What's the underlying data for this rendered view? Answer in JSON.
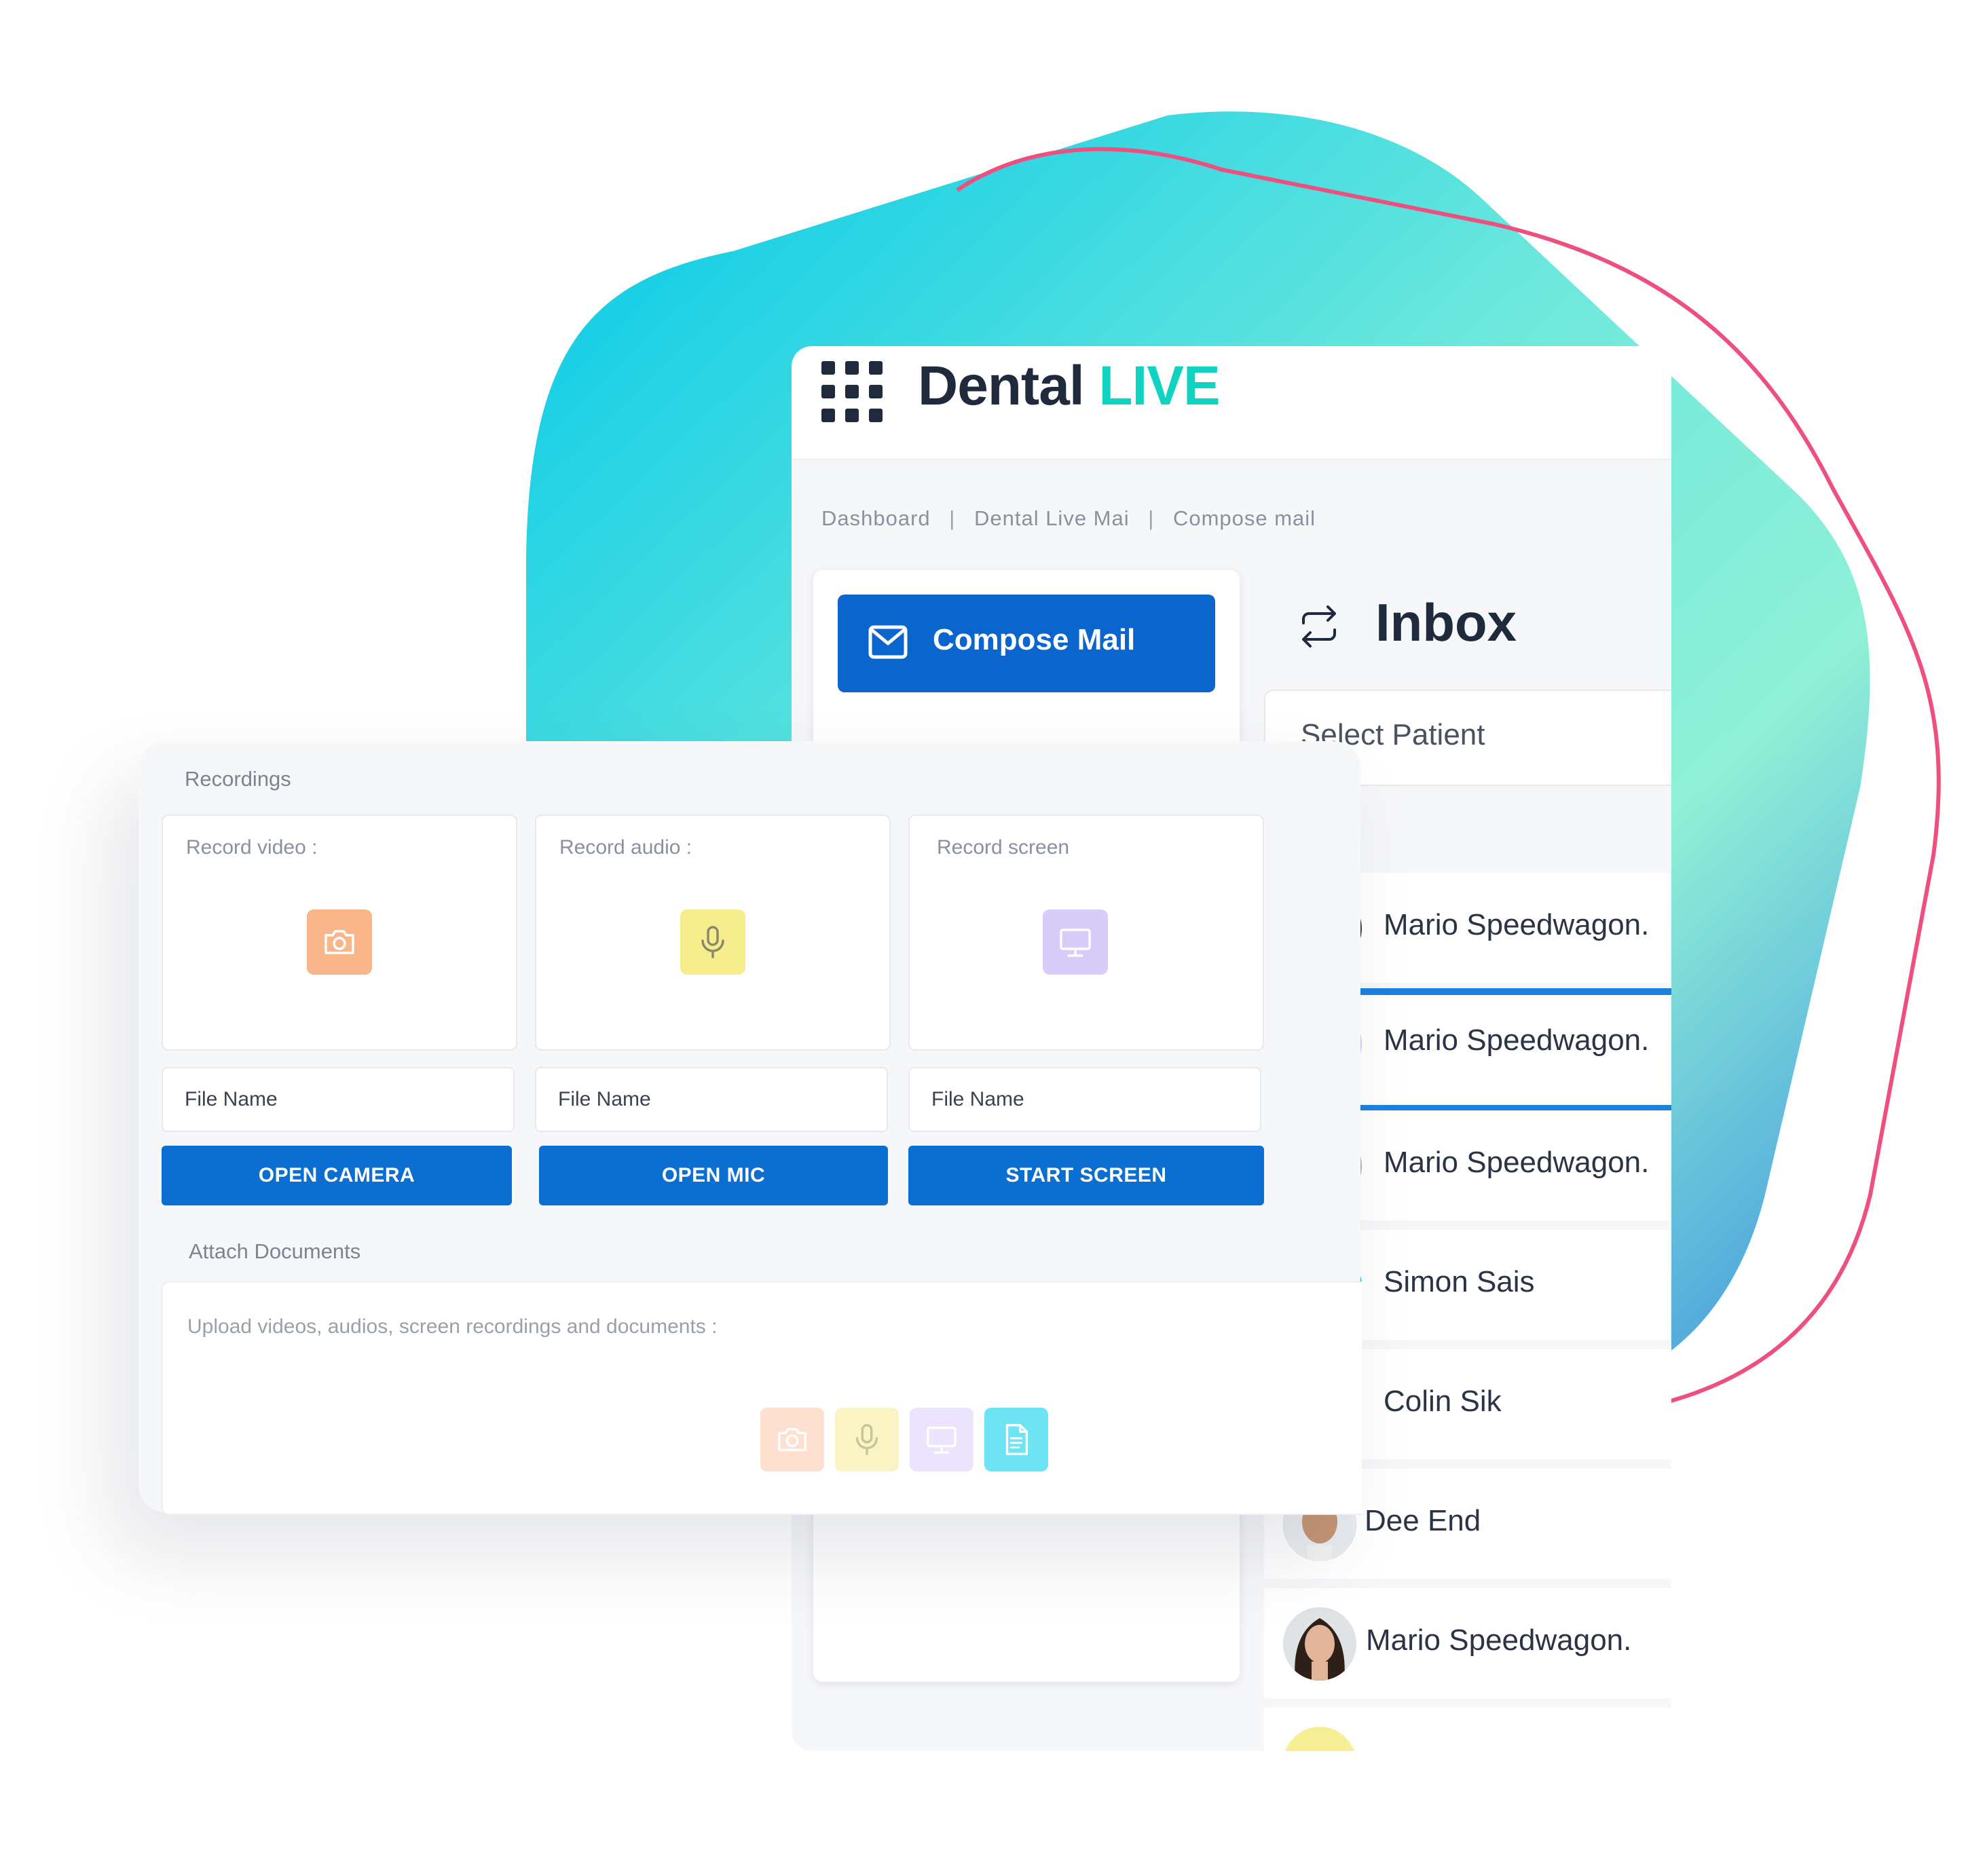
{
  "brand": {
    "name_part1": "Dental",
    "name_part2": "LIVE",
    "accent_color": "#0fd3c0",
    "primary_color": "#0a66cc"
  },
  "breadcrumb": [
    "Dashboard",
    "Dental Live Mai",
    "Compose mail"
  ],
  "compose": {
    "label": "Compose Mail",
    "icon": "mail-icon"
  },
  "inbox": {
    "title": "Inbox",
    "icon": "refresh-icon"
  },
  "patient_select": {
    "placeholder": "Select Patient"
  },
  "patients": [
    {
      "name": "Mario Speedwagon."
    },
    {
      "name": "Mario Speedwagon.",
      "selected": true
    },
    {
      "name": "Mario Speedwagon."
    },
    {
      "name": "Simon Sais"
    },
    {
      "name": "Colin Sik"
    },
    {
      "name": "Dee End"
    },
    {
      "name": "Mario Speedwagon."
    }
  ],
  "recordings": {
    "section_label": "Recordings",
    "cards": [
      {
        "label": "Record video :",
        "icon": "camera-icon",
        "file_placeholder": "File Name",
        "button": "OPEN CAMERA"
      },
      {
        "label": "Record audio :",
        "icon": "microphone-icon",
        "file_placeholder": "File Name",
        "button": "OPEN MIC"
      },
      {
        "label": "Record screen",
        "icon": "monitor-icon",
        "file_placeholder": "File Name",
        "button": "START SCREEN"
      }
    ]
  },
  "attach": {
    "section_label": "Attach Documents",
    "upload_label": "Upload videos, audios, screen recordings and documents :",
    "buttons": [
      "camera-icon",
      "microphone-icon",
      "monitor-icon",
      "document-icon"
    ]
  }
}
